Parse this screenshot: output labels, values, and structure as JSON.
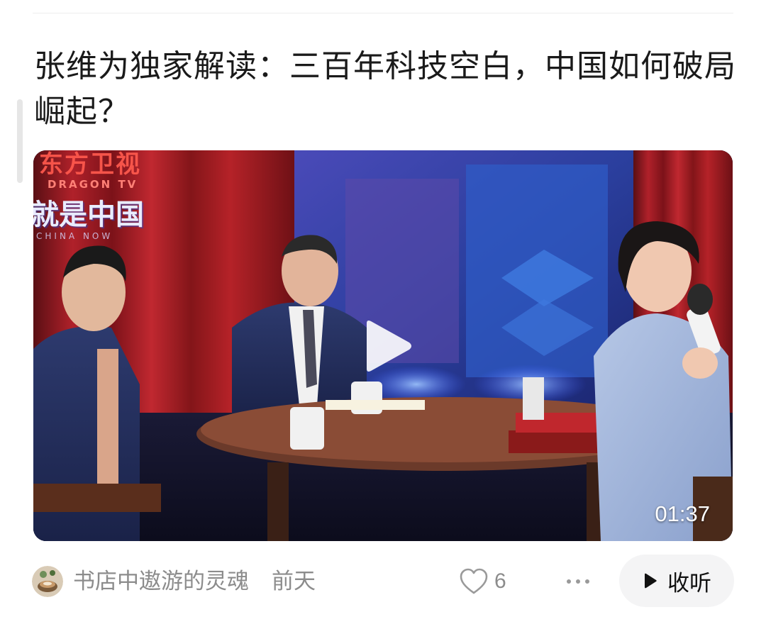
{
  "article": {
    "title": "张维为独家解读：三百年科技空白，中国如何破局崛起？"
  },
  "video": {
    "duration": "01:37",
    "watermark_channel": "东方卫视",
    "watermark_channel_en": "DRAGON TV",
    "watermark_show": "就是中国",
    "watermark_show_en": "CHINA NOW",
    "play_icon": "play-icon"
  },
  "meta": {
    "author": "书店中遨游的灵魂",
    "time": "前天",
    "like_icon": "heart-outline-icon",
    "like_count": "6",
    "more_icon": "more-dots-icon",
    "listen_icon": "play-triangle-icon",
    "listen_label": "收听"
  },
  "colors": {
    "title_text": "#1a1a1a",
    "meta_text": "#8c8c8c",
    "listen_bg": "#f4f4f5"
  }
}
